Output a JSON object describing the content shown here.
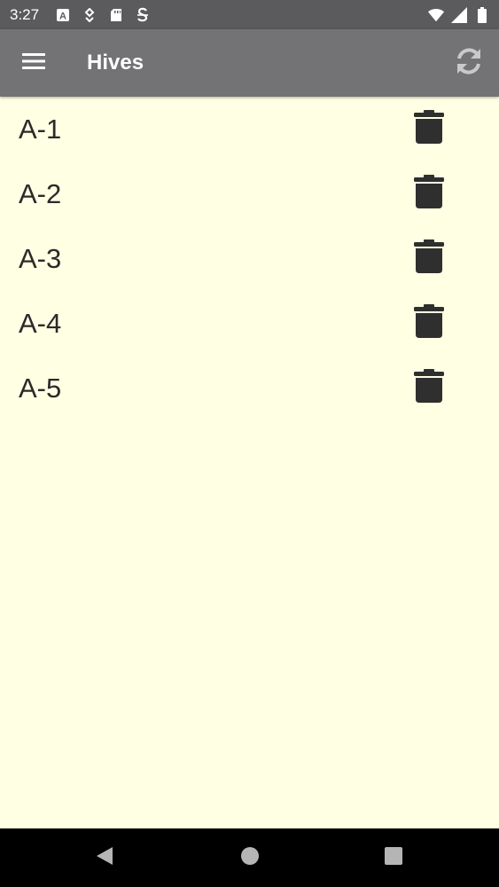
{
  "status_bar": {
    "time": "3:27",
    "icons": [
      "a-box-icon",
      "transfer-icon",
      "sd-card-icon",
      "s-notification-icon",
      "wifi-icon",
      "signal-icon",
      "battery-icon"
    ]
  },
  "app_bar": {
    "title": "Hives",
    "menu_icon": "hamburger-menu-icon",
    "refresh_icon": "refresh-icon"
  },
  "hives": [
    {
      "label": "A-1"
    },
    {
      "label": "A-2"
    },
    {
      "label": "A-3"
    },
    {
      "label": "A-4"
    },
    {
      "label": "A-5"
    }
  ],
  "row_action_icon": "trash-icon",
  "nav_bar": {
    "back_icon": "back-triangle-icon",
    "home_icon": "home-circle-icon",
    "recents_icon": "recents-square-icon"
  },
  "colors": {
    "background": "#ffffe3",
    "status_bar": "#5b5b5d",
    "app_bar": "#737274",
    "text": "#2a2a2a",
    "icon": "#2f2f2f"
  }
}
